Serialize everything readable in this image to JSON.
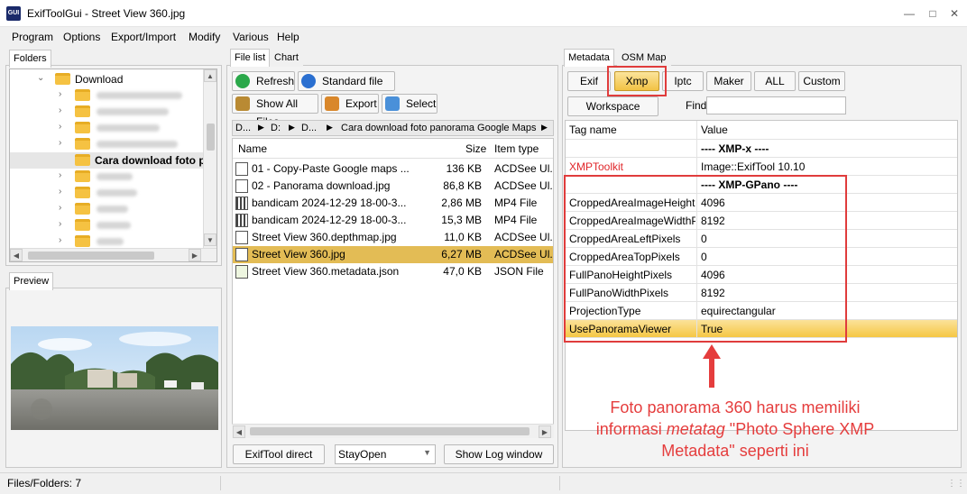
{
  "window": {
    "title": "ExifToolGui - Street View 360.jpg",
    "icon_text": "GUI"
  },
  "menu": [
    "Program",
    "Options",
    "Export/Import",
    "Modify",
    "Various",
    "Help"
  ],
  "folders": {
    "tab": "Folders",
    "items": [
      {
        "label": "Download"
      },
      {
        "label": "Cara download foto pa"
      }
    ]
  },
  "preview": {
    "tab": "Preview"
  },
  "file_panel": {
    "tabs": [
      "File list",
      "Chart"
    ],
    "refresh": "Refresh",
    "standard_list": "Standard file list",
    "show_all": "Show All Files",
    "export": "Export",
    "select": "Select",
    "breadcrumb": [
      "D...",
      "D:",
      "D...",
      "Cara download foto panorama Google Maps"
    ],
    "columns": [
      "Name",
      "Size",
      "Item type"
    ],
    "files": [
      {
        "name": "01 - Copy-Paste Google maps ...",
        "size": "136 KB",
        "type": "ACDSee Ul..."
      },
      {
        "name": "02 - Panorama download.jpg",
        "size": "86,8 KB",
        "type": "ACDSee Ul..."
      },
      {
        "name": "bandicam 2024-12-29 18-00-3...",
        "size": "2,86 MB",
        "type": "MP4 File"
      },
      {
        "name": "bandicam 2024-12-29 18-00-3...",
        "size": "15,3 MB",
        "type": "MP4 File"
      },
      {
        "name": "Street View 360.depthmap.jpg",
        "size": "11,0 KB",
        "type": "ACDSee Ul..."
      },
      {
        "name": "Street View 360.jpg",
        "size": "6,27 MB",
        "type": "ACDSee Ul..."
      },
      {
        "name": "Street View 360.metadata.json",
        "size": "47,0 KB",
        "type": "JSON File"
      }
    ],
    "exiftool_direct": "ExifTool direct",
    "stay_open": "StayOpen",
    "show_log": "Show Log window"
  },
  "meta_panel": {
    "tabs": [
      "Metadata",
      "OSM Map"
    ],
    "buttons": [
      "Exif",
      "Xmp",
      "Iptc",
      "Maker",
      "ALL",
      "Custom"
    ],
    "workspace": "Workspace",
    "find_label": "Find",
    "columns": [
      "Tag name",
      "Value"
    ],
    "rows": [
      {
        "tag": "",
        "value": "---- XMP-x ----"
      },
      {
        "tag": "XMPToolkit",
        "value": "Image::ExifTool 10.10"
      },
      {
        "tag": "",
        "value": "---- XMP-GPano ----"
      },
      {
        "tag": "CroppedAreaImageHeight",
        "value": "4096"
      },
      {
        "tag": "CroppedAreaImageWidthP",
        "value": "8192"
      },
      {
        "tag": "CroppedAreaLeftPixels",
        "value": "0"
      },
      {
        "tag": "CroppedAreaTopPixels",
        "value": "0"
      },
      {
        "tag": "FullPanoHeightPixels",
        "value": "4096"
      },
      {
        "tag": "FullPanoWidthPixels",
        "value": "8192"
      },
      {
        "tag": "ProjectionType",
        "value": "equirectangular"
      },
      {
        "tag": "UsePanoramaViewer",
        "value": "True"
      }
    ]
  },
  "annotation": {
    "line1": "Foto panorama 360 harus memiliki",
    "line2_a": "informasi ",
    "line2_b": "metatag",
    "line2_c": " \"Photo Sphere XMP",
    "line3": "Metadata\" seperti ini"
  },
  "status": {
    "text": "Files/Folders: 7"
  },
  "colors": {
    "accent_red": "#e03c3c",
    "selection": "#e3bc55",
    "tag_red": "#e0262a"
  }
}
